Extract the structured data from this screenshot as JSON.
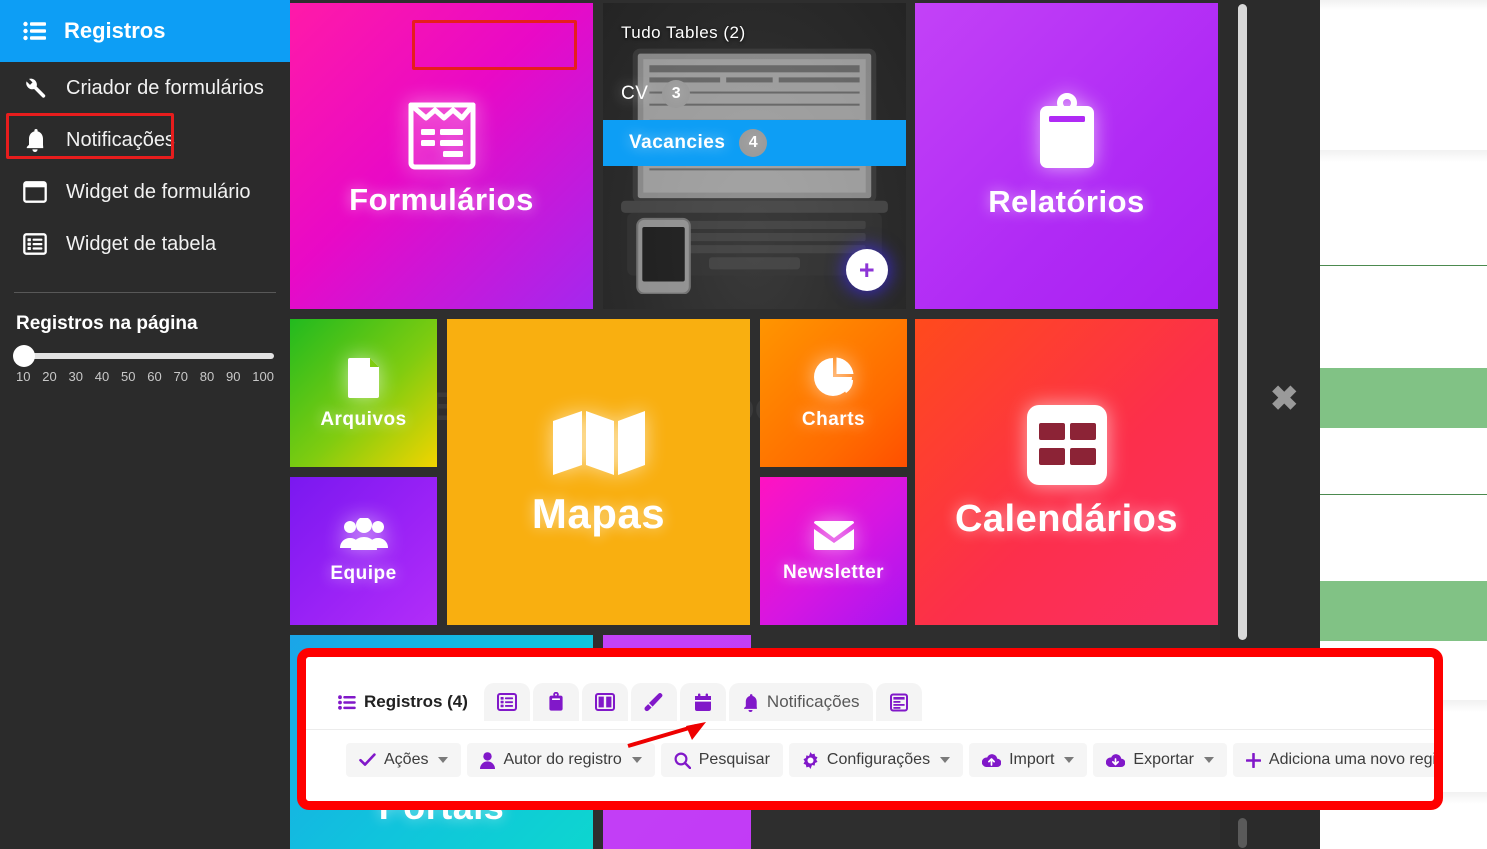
{
  "sidebar": {
    "header": {
      "label": "Registros",
      "icon": "list-icon"
    },
    "items": [
      {
        "label": "Criador de formulários",
        "icon": "wrench-icon",
        "highlighted": false
      },
      {
        "label": "Notificações",
        "icon": "bell-icon",
        "highlighted": true
      },
      {
        "label": "Widget de formulário",
        "icon": "window-icon",
        "highlighted": false
      },
      {
        "label": "Widget de tabela",
        "icon": "table-list-icon",
        "highlighted": false
      }
    ],
    "slider": {
      "title": "Registros na página",
      "value": "10",
      "scale": [
        "10",
        "20",
        "30",
        "40",
        "50",
        "60",
        "70",
        "80",
        "90",
        "100"
      ]
    }
  },
  "tiles": {
    "forms": {
      "label": "Formulários",
      "icon": "form-icon",
      "color": "#e909c6"
    },
    "reports": {
      "label": "Relatórios",
      "icon": "clipboard-icon",
      "color": "#b02af5"
    },
    "files": {
      "label": "Arquivos",
      "icon": "file-icon",
      "color": "#7fcc10"
    },
    "team": {
      "label": "Equipe",
      "icon": "users-icon",
      "color": "#9a22f6"
    },
    "maps": {
      "label": "Mapas",
      "icon": "map-icon",
      "color": "#f9af10"
    },
    "charts": {
      "label": "Charts",
      "icon": "pie-chart-icon",
      "color": "#ff6a00"
    },
    "newsletter": {
      "label": "Newsletter",
      "icon": "envelope-icon",
      "color": "#d516e2"
    },
    "calendars": {
      "label": "Calendários",
      "icon": "calendar-grid-icon",
      "color": "#fc2f4b"
    },
    "portals": {
      "label": "Portals",
      "icon": "portal-icon",
      "color": "#10c3dd"
    }
  },
  "tables_card": {
    "title": "Tudo Tables (2)",
    "add_button": "+",
    "rows": [
      {
        "label": "CV",
        "count": "3",
        "selected": false
      },
      {
        "label": "Vacancies",
        "count": "4",
        "selected": true
      }
    ]
  },
  "panel": {
    "tabs": [
      {
        "label": "Registros (4)",
        "icon": "list-icon",
        "active": true,
        "icon_only": false,
        "highlighted": false
      },
      {
        "label": "",
        "icon": "table-list-icon",
        "active": false,
        "icon_only": true,
        "highlighted": false
      },
      {
        "label": "",
        "icon": "clipboard-icon",
        "active": false,
        "icon_only": true,
        "highlighted": false
      },
      {
        "label": "",
        "icon": "columns-icon",
        "active": false,
        "icon_only": true,
        "highlighted": false
      },
      {
        "label": "",
        "icon": "paintbrush-icon",
        "active": false,
        "icon_only": true,
        "highlighted": false
      },
      {
        "label": "",
        "icon": "calendar-icon",
        "active": false,
        "icon_only": true,
        "highlighted": false
      },
      {
        "label": "Notificações",
        "icon": "bell-icon",
        "active": false,
        "icon_only": false,
        "highlighted": true
      },
      {
        "label": "",
        "icon": "form-list-icon",
        "active": false,
        "icon_only": true,
        "highlighted": false
      }
    ],
    "toolbar": [
      {
        "label": "Ações",
        "icon": "check-icon",
        "caret": true
      },
      {
        "label": "Autor do registro",
        "icon": "user-icon",
        "caret": true
      },
      {
        "label": "Pesquisar",
        "icon": "search-icon",
        "caret": false
      },
      {
        "label": "Configurações",
        "icon": "gear-icon",
        "caret": true
      },
      {
        "label": "Import",
        "icon": "cloud-upload-icon",
        "caret": true
      },
      {
        "label": "Exportar",
        "icon": "cloud-download-icon",
        "caret": true
      },
      {
        "label": "Adiciona uma novo registro",
        "icon": "plus-icon",
        "caret": false
      }
    ]
  },
  "overlay": {
    "close_label": "✖",
    "highlight_color": "#ff0000",
    "accent_blue": "#0d9ef5",
    "accent_purple": "#8118c9"
  },
  "ghost_text": {
    "line1": "Elementary School"
  }
}
